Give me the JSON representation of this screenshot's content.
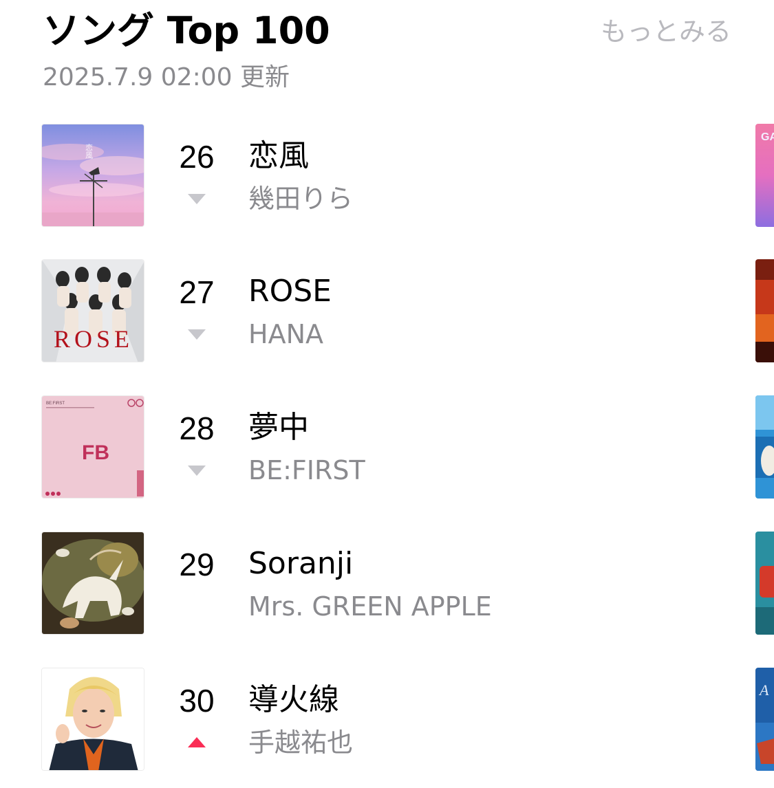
{
  "header": {
    "title": "ソング Top 100",
    "more_label": "もっとみる",
    "updated": "2025.7.9 02:00 更新"
  },
  "colors": {
    "trend_down": "#c7c7cc",
    "trend_up": "#fa2d55",
    "secondary_text": "#8a8a8e",
    "more_text": "#b9b9be"
  },
  "songs": [
    {
      "rank": "26",
      "title": "恋風",
      "artist": "幾田りら",
      "trend": "down",
      "art_lettering": "恋風"
    },
    {
      "rank": "27",
      "title": "ROSE",
      "artist": "HANA",
      "trend": "down",
      "art_lettering": "ROSE"
    },
    {
      "rank": "28",
      "title": "夢中",
      "artist": "BE:FIRST",
      "trend": "down",
      "art_lettering": "BE:FIRST"
    },
    {
      "rank": "29",
      "title": "Soranji",
      "artist": "Mrs. GREEN APPLE",
      "trend": "none",
      "art_lettering": ""
    },
    {
      "rank": "30",
      "title": "導火線",
      "artist": "手越祐也",
      "trend": "up",
      "art_lettering": ""
    }
  ],
  "adjacent_column_peek": [
    {
      "art_lettering": "GA"
    },
    {
      "art_lettering": ""
    },
    {
      "art_lettering": ""
    },
    {
      "art_lettering": ""
    },
    {
      "art_lettering": "A"
    }
  ]
}
